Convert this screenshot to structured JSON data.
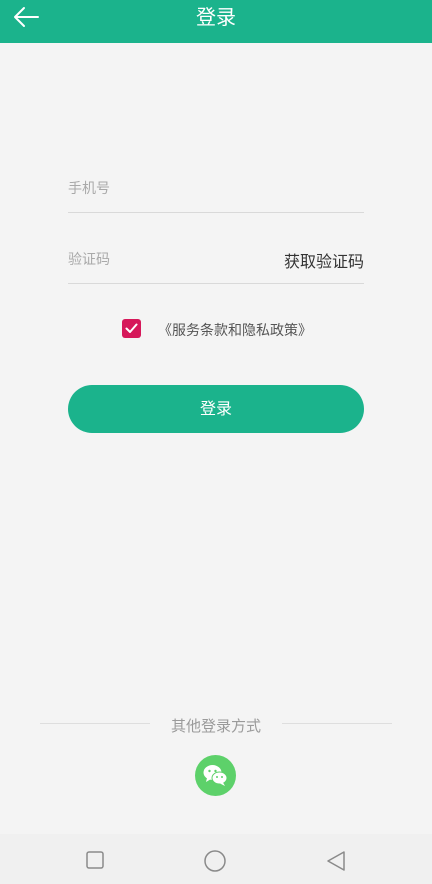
{
  "header": {
    "title": "登录",
    "back_icon": "arrow-left-icon"
  },
  "form": {
    "phone_placeholder": "手机号",
    "code_placeholder": "验证码",
    "get_code_label": "获取验证码",
    "agreement_checked": true,
    "agreement_text": "《服务条款和隐私政策》",
    "login_label": "登录"
  },
  "other_login": {
    "label": "其他登录方式",
    "wechat_icon": "wechat-icon"
  },
  "system_nav": {
    "recents_icon": "square-icon",
    "home_icon": "circle-icon",
    "back_icon": "triangle-back-icon"
  },
  "colors": {
    "primary": "#1bb38c",
    "checkbox": "#d6185a",
    "wechat": "#5dd16a",
    "background": "#f4f4f4"
  }
}
